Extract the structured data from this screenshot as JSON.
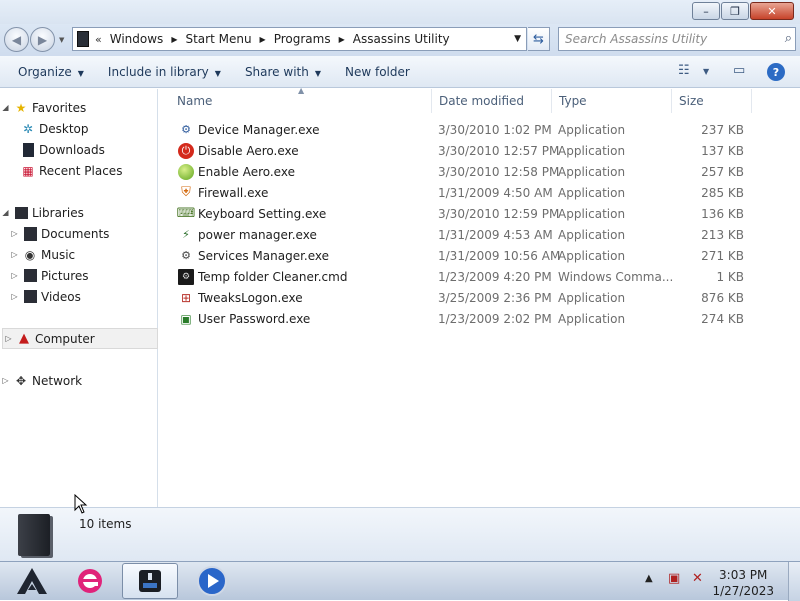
{
  "window": {
    "buttons": {
      "minimize": "–",
      "maximize": "❐",
      "close": "✕"
    }
  },
  "address": {
    "overflow": "«",
    "crumbs": [
      "Windows",
      "Start Menu",
      "Programs",
      "Assassins Utility"
    ]
  },
  "search": {
    "placeholder": "Search Assassins Utility"
  },
  "toolbar": {
    "organize": "Organize",
    "include": "Include in library",
    "share": "Share with",
    "new_folder": "New folder"
  },
  "sidebar": {
    "favorites": "Favorites",
    "desktop": "Desktop",
    "downloads": "Downloads",
    "recent": "Recent Places",
    "libraries": "Libraries",
    "documents": "Documents",
    "music": "Music",
    "pictures": "Pictures",
    "videos": "Videos",
    "computer": "Computer",
    "network": "Network"
  },
  "columns": {
    "name": "Name",
    "date": "Date modified",
    "type": "Type",
    "size": "Size"
  },
  "files": [
    {
      "name": "Device Manager.exe",
      "date": "3/30/2010 1:02 PM",
      "type": "Application",
      "size": "237 KB",
      "icon": "device-manager-icon"
    },
    {
      "name": "Disable Aero.exe",
      "date": "3/30/2010 12:57 PM",
      "type": "Application",
      "size": "137 KB",
      "icon": "power-red-icon"
    },
    {
      "name": "Enable Aero.exe",
      "date": "3/30/2010 12:58 PM",
      "type": "Application",
      "size": "257 KB",
      "icon": "green-orb-icon"
    },
    {
      "name": "Firewall.exe",
      "date": "1/31/2009 4:50 AM",
      "type": "Application",
      "size": "285 KB",
      "icon": "shield-icon"
    },
    {
      "name": "Keyboard Setting.exe",
      "date": "3/30/2010 12:59 PM",
      "type": "Application",
      "size": "136 KB",
      "icon": "keyboard-icon"
    },
    {
      "name": "power manager.exe",
      "date": "1/31/2009 4:53 AM",
      "type": "Application",
      "size": "213 KB",
      "icon": "power-manager-icon"
    },
    {
      "name": "Services Manager.exe",
      "date": "1/31/2009 10:56 AM",
      "type": "Application",
      "size": "271 KB",
      "icon": "gears-icon"
    },
    {
      "name": "Temp folder Cleaner.cmd",
      "date": "1/23/2009 4:20 PM",
      "type": "Windows Comma...",
      "size": "1 KB",
      "icon": "cmd-icon"
    },
    {
      "name": "TweaksLogon.exe",
      "date": "3/25/2009 2:36 PM",
      "type": "Application",
      "size": "876 KB",
      "icon": "logon-icon"
    },
    {
      "name": "User Password.exe",
      "date": "1/23/2009 2:02 PM",
      "type": "Application",
      "size": "274 KB",
      "icon": "password-icon"
    }
  ],
  "details": {
    "count": "10 items"
  },
  "clock": {
    "time": "3:03 PM",
    "date": "1/27/2023"
  }
}
